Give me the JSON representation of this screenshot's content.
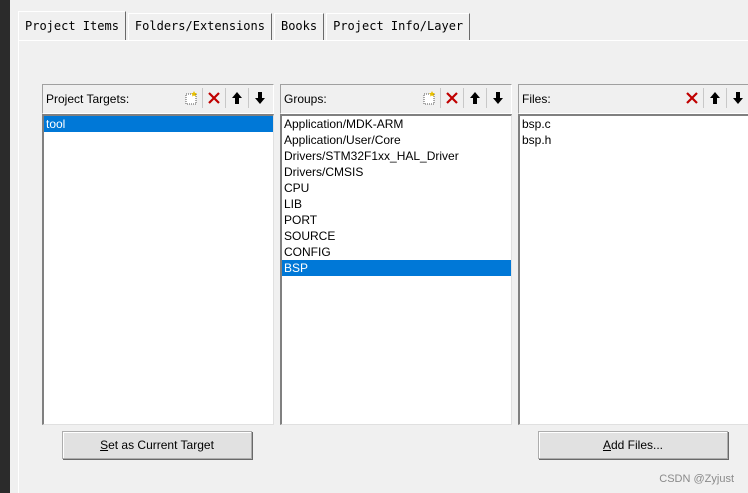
{
  "tabs": [
    {
      "label": "Project Items",
      "active": true
    },
    {
      "label": "Folders/Extensions",
      "active": false
    },
    {
      "label": "Books",
      "active": false
    },
    {
      "label": "Project Info/Layer",
      "active": false
    }
  ],
  "targets_panel": {
    "title": "Project Targets:",
    "items": [
      "tool"
    ],
    "selected_index": 0
  },
  "groups_panel": {
    "title": "Groups:",
    "items": [
      "Application/MDK-ARM",
      "Application/User/Core",
      "Drivers/STM32F1xx_HAL_Driver",
      "Drivers/CMSIS",
      "CPU",
      "LIB",
      "PORT",
      "SOURCE",
      "CONFIG",
      "BSP"
    ],
    "selected_index": 9
  },
  "files_panel": {
    "title": "Files:",
    "items": [
      "bsp.c",
      "bsp.h"
    ]
  },
  "buttons": {
    "set_current_accel": "S",
    "set_current_rest": "et as Current Target",
    "add_files_accel": "A",
    "add_files_rest": "dd Files..."
  },
  "watermark": "CSDN @Zyjust",
  "colors": {
    "selection": "#0078d7",
    "delete": "#c00000"
  }
}
